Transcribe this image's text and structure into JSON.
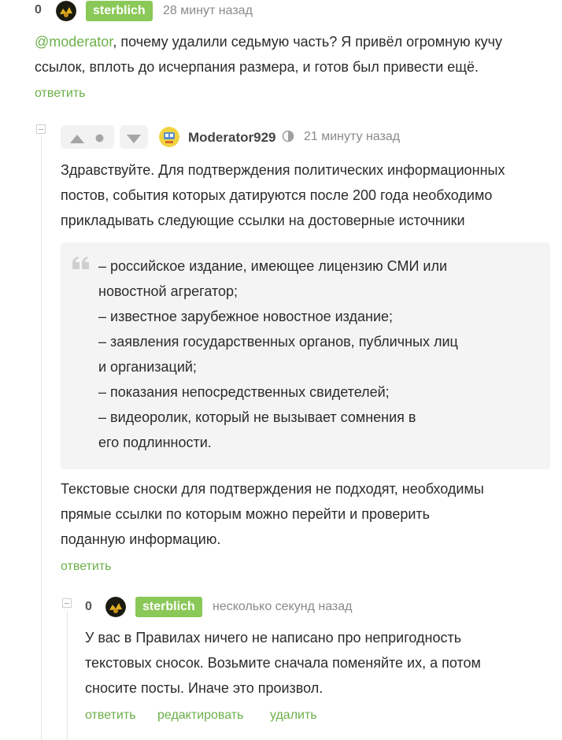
{
  "comment1": {
    "score": "0",
    "author": "sterblich",
    "time": "28 минут назад",
    "mention": "@moderator",
    "text_line1_rest": ", почему удалили седьмую часть? Я привёл огромную кучу",
    "text_line2": "ссылок, вплоть до исчерпания размера, и готов был привести ещё.",
    "reply": "ответить"
  },
  "comment2": {
    "author": "Moderator929",
    "time": "21 минуту назад",
    "text_lines": [
      "Здравствуйте. Для подтверждения политических информационных",
      "постов, события которых датируются после 200 года необходимо",
      "прикладывать следующие ссылки на достоверные источники"
    ],
    "quote_lines": [
      "– российское издание, имеющее лицензию СМИ или",
      "новостной агрегатор;",
      "– известное зарубежное новостное издание;",
      "– заявления государственных органов, публичных лиц",
      "и организаций;",
      "– показания непосредственных свидетелей;",
      "– видеоролик, который не вызывает сомнения в",
      "его подлинности."
    ],
    "after_lines": [
      "Текстовые сноски для подтверждения не подходят, необходимы",
      "прямые ссылки по которым можно перейти и проверить",
      "поданную информацию."
    ],
    "reply": "ответить"
  },
  "comment3": {
    "score": "0",
    "author": "sterblich",
    "time": "несколько секунд назад",
    "text_lines": [
      "У вас в Правилах ничего не написано про непригодность",
      "текстовых сносок. Возьмите сначала поменяйте их, а потом",
      "сносите посты. Иначе это произвол."
    ],
    "reply": "ответить",
    "edit": "редактировать",
    "delete": "удалить"
  },
  "colors": {
    "accent": "#8ac858",
    "link": "#6bb04a",
    "quote_bg": "#f4f4f4"
  }
}
